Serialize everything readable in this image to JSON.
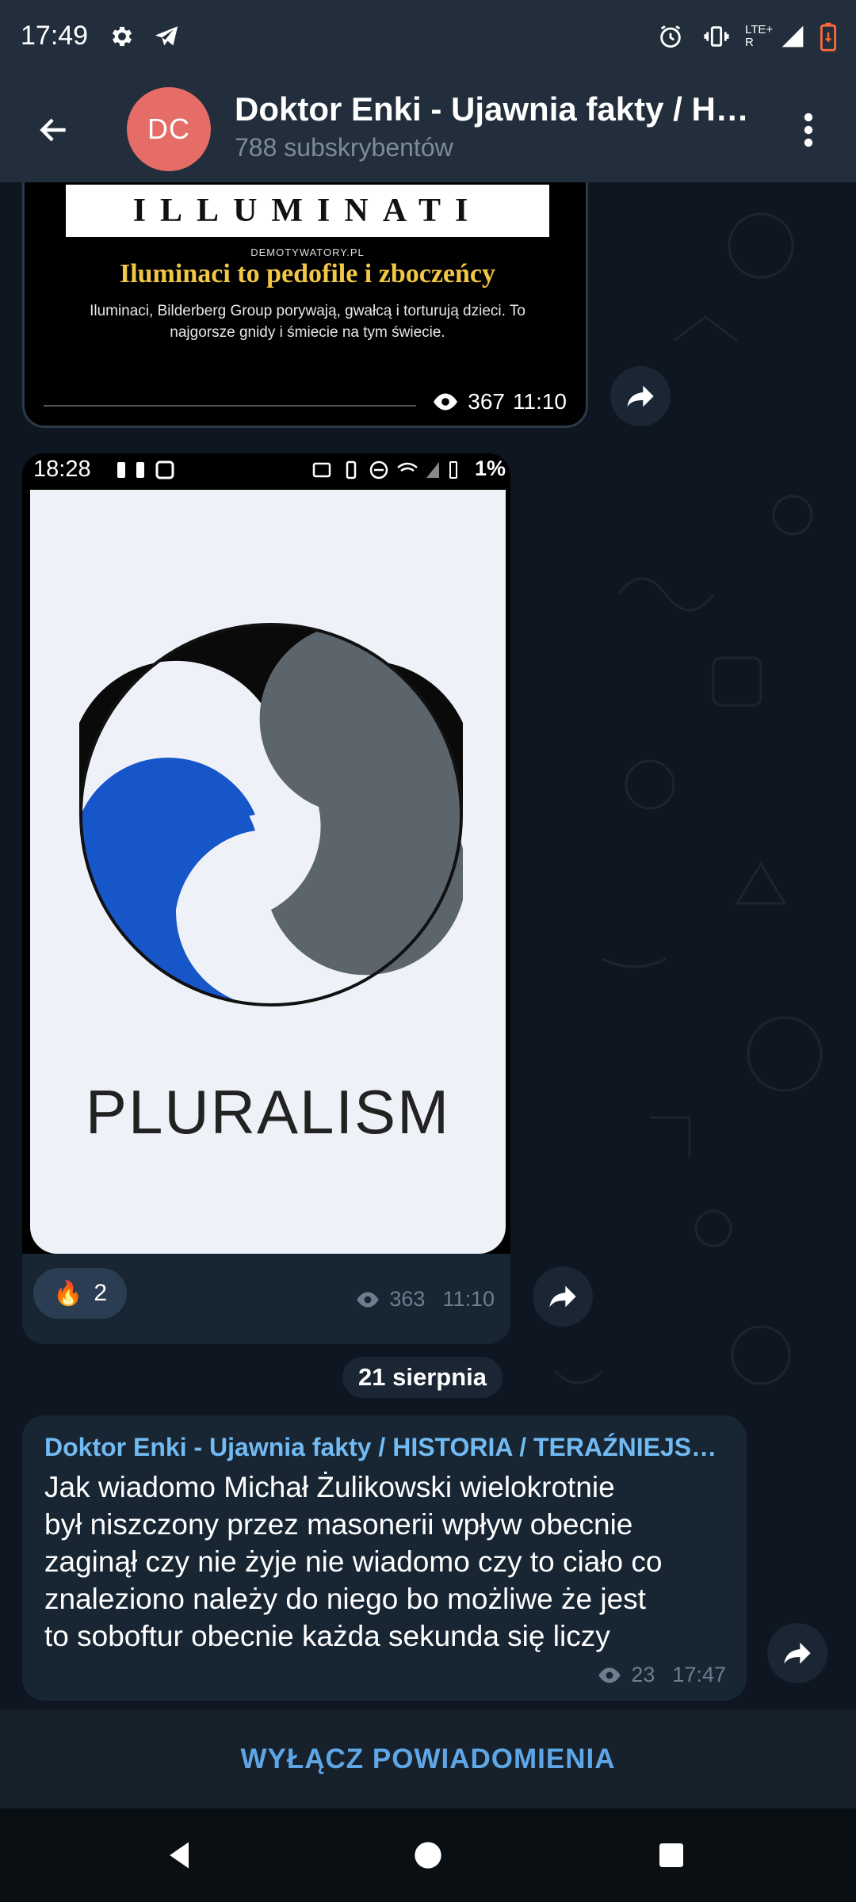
{
  "status_bar": {
    "time": "17:49",
    "network_label": "LTE+ R",
    "icons": [
      "settings-icon",
      "telegram-icon",
      "alarm-icon",
      "vibrate-icon",
      "signal-icon",
      "battery-low-icon"
    ]
  },
  "header": {
    "avatar_initials": "DC",
    "avatar_color": "#e56c67",
    "title": "Doktor Enki - Ujawnia fakty / HI…",
    "subtitle": "788 subskrybentów"
  },
  "messages": [
    {
      "banner_text": "ILLUMINATI",
      "source_text": "DEMOTYWATORY.PL",
      "caption": "Iluminaci to pedofile i zboczeńcy",
      "body_lines": [
        "Iluminaci, Bilderberg Group porywają, gwałcą i torturują dzieci. To",
        "najgorsze gnidy i śmiecie na tym świecie."
      ],
      "views": "367",
      "time": "11:10"
    },
    {
      "screenshot_time": "18:28",
      "screenshot_battery": "1%",
      "image_text": "PLURALISM",
      "reaction_emoji": "🔥",
      "reaction_count": "2",
      "views": "363",
      "time": "11:10"
    },
    {
      "author": "Doktor Enki - Ujawnia fakty / HISTORIA / TERAŹNIEJS…",
      "text_lines": [
        "Jak wiadomo Michał Żulikowski wielokrotnie",
        "był niszczony przez masonerii wpływ obecnie",
        "zaginął czy nie żyje nie wiadomo czy to ciało co",
        "znaleziono należy do niego bo możliwe że jest",
        "to soboftur obecnie każda sekunda się liczy"
      ],
      "views": "23",
      "time": "17:47"
    }
  ],
  "date_separator": "21 sierpnia",
  "bottom_bar": {
    "mute_label": "WYŁĄCZ POWIADOMIENIA"
  },
  "colors": {
    "header_bg": "#232e3c",
    "chat_bg": "#0e1621",
    "bubble_bg": "#182533",
    "accent": "#5ea6e6",
    "author_link": "#71baf2"
  }
}
